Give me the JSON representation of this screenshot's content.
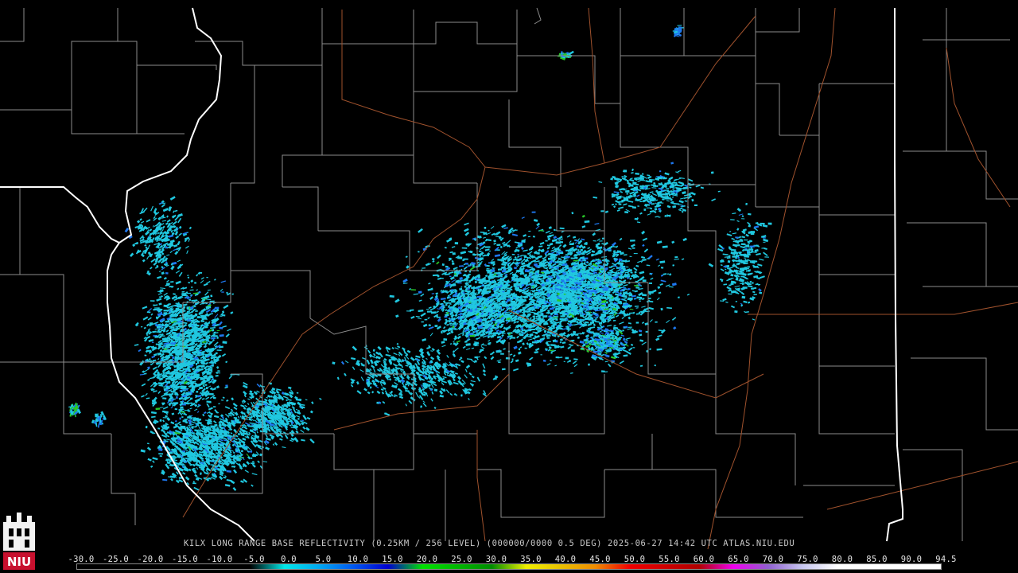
{
  "caption": "KILX LONG RANGE BASE REFLECTIVITY (0.25KM / 256 LEVEL) (000000/0000 0.5 DEG) 2025-06-27 14:42 UTC  ATLAS.NIU.EDU",
  "logo_text": "NIU",
  "scale": {
    "labels": [
      "-30.0",
      "-25.0",
      "-20.0",
      "-15.0",
      "-10.0",
      "-5.0",
      "0.0",
      "5.0",
      "10.0",
      "15.0",
      "20.0",
      "25.0",
      "30.0",
      "35.0",
      "40.0",
      "45.0",
      "50.0",
      "55.0",
      "60.0",
      "65.0",
      "70.0",
      "75.0",
      "80.0",
      "85.0",
      "90.0",
      "94.5"
    ],
    "values": [
      -30,
      -25,
      -20,
      -15,
      -10,
      -5,
      0,
      5,
      10,
      15,
      20,
      25,
      30,
      35,
      40,
      45,
      50,
      55,
      60,
      65,
      70,
      75,
      80,
      85,
      90,
      94.5
    ],
    "colors": [
      "#000000",
      "#000000",
      "#000000",
      "#000000",
      "#000000",
      "#000000",
      "#00e8e8",
      "#00a8f0",
      "#0058f0",
      "#0000d0",
      "#00e000",
      "#00b800",
      "#008c00",
      "#f0f000",
      "#e8c000",
      "#f08c00",
      "#f00000",
      "#d00000",
      "#b00000",
      "#f000f0",
      "#9060d0",
      "#c8c8f0",
      "#ffffff",
      "#ffffff",
      "#ffffff",
      "#ffffff"
    ]
  },
  "colors": {
    "state_border": "#ffffff",
    "county_line": "#8c8c8c",
    "highway": "#a0522d",
    "echo_low": "#20c8e0",
    "echo_mid": "#1e78f0",
    "echo_high": "#28c828"
  }
}
